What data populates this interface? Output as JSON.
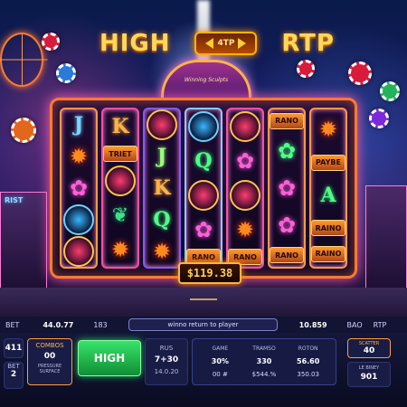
{
  "title": {
    "left_word": "HIGH",
    "badge_text": "4TP",
    "right_word": "RTP"
  },
  "marquee": {
    "text": "Winning Sculpts"
  },
  "reels": [
    [
      {
        "kind": "letter",
        "text": "J",
        "color": "#7bd4ff"
      },
      {
        "kind": "flame",
        "text": "✹"
      },
      {
        "kind": "flower",
        "text": "✿"
      },
      {
        "kind": "orb-blue",
        "text": ""
      },
      {
        "kind": "orb",
        "text": ""
      }
    ],
    [
      {
        "kind": "letter",
        "text": "K",
        "color": "#ffb347"
      },
      {
        "kind": "tag",
        "text": "TRIET"
      },
      {
        "kind": "orb",
        "text": ""
      },
      {
        "kind": "leaf",
        "text": "❦"
      },
      {
        "kind": "flame",
        "text": "✹"
      }
    ],
    [
      {
        "kind": "orb",
        "text": ""
      },
      {
        "kind": "letter",
        "text": "J",
        "color": "#9cff7a"
      },
      {
        "kind": "letter",
        "text": "K",
        "color": "#ffb347"
      },
      {
        "kind": "letter",
        "text": "Q",
        "color": "#4dff86"
      },
      {
        "kind": "flame",
        "text": "✹"
      }
    ],
    [
      {
        "kind": "orb-blue",
        "text": ""
      },
      {
        "kind": "letter",
        "text": "Q",
        "color": "#4dff86"
      },
      {
        "kind": "orb",
        "text": ""
      },
      {
        "kind": "flower",
        "text": "✿"
      },
      {
        "kind": "tag",
        "text": "RANO"
      }
    ],
    [
      {
        "kind": "orb",
        "text": ""
      },
      {
        "kind": "flower",
        "text": "✿"
      },
      {
        "kind": "orb",
        "text": ""
      },
      {
        "kind": "flame",
        "text": "✹"
      },
      {
        "kind": "tag",
        "text": "RANO"
      }
    ],
    [
      {
        "kind": "tag",
        "text": "RANO"
      },
      {
        "kind": "flower-green",
        "text": "✿"
      },
      {
        "kind": "flower",
        "text": "✿"
      },
      {
        "kind": "flower",
        "text": "✿"
      },
      {
        "kind": "tag",
        "text": "RANO"
      }
    ],
    [
      {
        "kind": "flame",
        "text": "✹"
      },
      {
        "kind": "tag",
        "text": "PAYBE"
      },
      {
        "kind": "letter",
        "text": "A",
        "color": "#4dff86"
      },
      {
        "kind": "tag",
        "text": "RAINO"
      },
      {
        "kind": "tag",
        "text": "RAINO"
      }
    ]
  ],
  "jackpot": "$119.38",
  "building_sign": "RIST",
  "strip": {
    "left_label": "BET",
    "bet_value": "44.0.77",
    "mid_label": "183",
    "rtp_banner": "winno return to player",
    "right_value": "10.859",
    "bag_label": "BAO",
    "rtp_label": "RTP"
  },
  "panel": {
    "left_box_1_label": "",
    "left_box_1_value": "411",
    "left_box_2_label": "BET",
    "left_box_2_value": "2",
    "orange_box_label": "COMBOS",
    "orange_box_value": "00",
    "orange_box_sub": "PRESSURE SURFACE",
    "high_button": "HIGH",
    "stats": [
      {
        "head": "RUS",
        "value": "7+30",
        "sub": "14.0.20"
      },
      {
        "head": "GAME",
        "value": "30%",
        "sub": "00 #"
      },
      {
        "head": "TRAMSO",
        "value": "330",
        "sub": "$544.%"
      },
      {
        "head": "ROTON",
        "value": "56.60",
        "sub": "350.03"
      }
    ],
    "right_box_1_label": "SCATTER",
    "right_box_1_value": "40",
    "right_box_2_label": "LE BINEY",
    "right_box_2_value": "901"
  }
}
